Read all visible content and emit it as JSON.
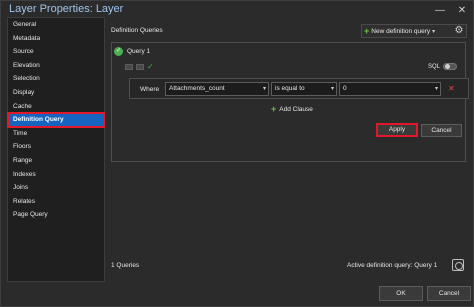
{
  "window": {
    "title": "Layer Properties: Layer",
    "minimize": "—",
    "close": "✕"
  },
  "sidebar": {
    "items": [
      {
        "label": "General"
      },
      {
        "label": "Metadata"
      },
      {
        "label": "Source"
      },
      {
        "label": "Elevation"
      },
      {
        "label": "Selection"
      },
      {
        "label": "Display"
      },
      {
        "label": "Cache"
      },
      {
        "label": "Definition Query",
        "selected": true
      },
      {
        "label": "Time"
      },
      {
        "label": "Floors"
      },
      {
        "label": "Range"
      },
      {
        "label": "Indexes"
      },
      {
        "label": "Joins"
      },
      {
        "label": "Relates"
      },
      {
        "label": "Page Query"
      }
    ]
  },
  "main": {
    "section_title": "Definition Queries",
    "new_query_label": "New definition query",
    "new_query_chevron": "▾",
    "gear_icon": "⚙"
  },
  "query": {
    "name": "Query 1",
    "sql_label": "SQL",
    "clause": {
      "where_label": "Where",
      "field": "Attachments_count",
      "operator": "is equal to",
      "value": "0"
    },
    "add_clause_label": "Add Clause",
    "apply_label": "Apply",
    "cancel_label": "Cancel"
  },
  "status": {
    "query_count": "1 Queries",
    "active_query": "Active definition query: Query 1"
  },
  "footer": {
    "ok_label": "OK",
    "cancel_label": "Cancel"
  },
  "colors": {
    "accent": "#1565c0",
    "highlight": "#e0182a",
    "success": "#4caf50",
    "title": "#9fc4ec"
  }
}
